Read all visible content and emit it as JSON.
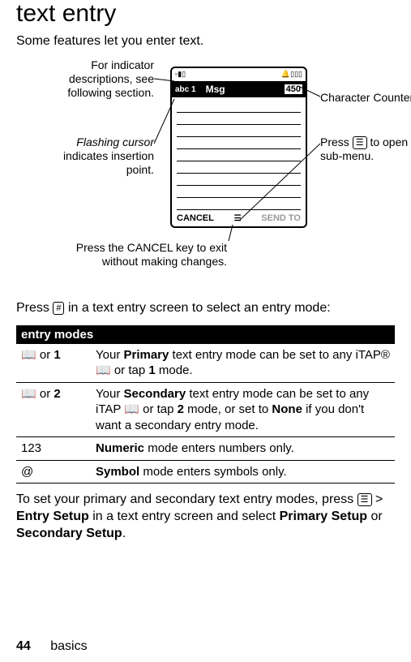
{
  "title": "text entry",
  "intro": "Some features let you enter text.",
  "diagram": {
    "status_left": "▫▮▯",
    "status_right": "🔔▯▯▯",
    "mode_indicator": "abc 1",
    "msg_label": "Msg",
    "char_counter": "450",
    "soft_left": "CANCEL",
    "soft_right": "SEND TO",
    "callouts": {
      "top_left_1": "For indicator",
      "top_left_2": "descriptions, see",
      "top_left_3": "following section.",
      "mid_left_1": "Flashing cursor",
      "mid_left_2": "indicates insertion",
      "mid_left_3": "point.",
      "bottom_1": "Press the CANCEL key to exit",
      "bottom_2": "without making changes.",
      "right_top": "Character Counter",
      "right_mid_1": "Press",
      "right_mid_2": "to open",
      "right_mid_3": "sub-menu."
    }
  },
  "press_line_1": "Press",
  "press_key": "#",
  "press_line_2": "in a text entry screen to select an entry mode:",
  "table_header": "entry modes",
  "rows": {
    "r1_sym_a": "📖",
    "r1_or": " or ",
    "r1_sym_b": "1",
    "r1_txt_a": "Your ",
    "r1_txt_b": "Primary",
    "r1_txt_c": " text entry mode can be set to any iTAP® 📖 or tap ",
    "r1_txt_d": "1",
    "r1_txt_e": " mode.",
    "r2_sym_a": "📖",
    "r2_sym_b": "2",
    "r2_txt_a": "Your ",
    "r2_txt_b": "Secondary",
    "r2_txt_c": " text entry mode can be set to any iTAP 📖 or tap ",
    "r2_txt_d": "2",
    "r2_txt_e": " mode, or set to ",
    "r2_txt_f": "None",
    "r2_txt_g": " if you don't want a secondary entry mode.",
    "r3_sym": "123",
    "r3_txt_a": "Numeric",
    "r3_txt_b": " mode enters numbers only.",
    "r4_sym": "@",
    "r4_txt_a": "Symbol",
    "r4_txt_b": " mode enters symbols only."
  },
  "set_1": "To set your primary and secondary text entry modes, press ",
  "set_2": " > ",
  "set_3": "Entry Setup",
  "set_4": " in a text entry screen and select ",
  "set_5": "Primary Setup",
  "set_6": " or ",
  "set_7": "Secondary Setup",
  "set_8": ".",
  "page_num": "44",
  "page_label": "basics"
}
